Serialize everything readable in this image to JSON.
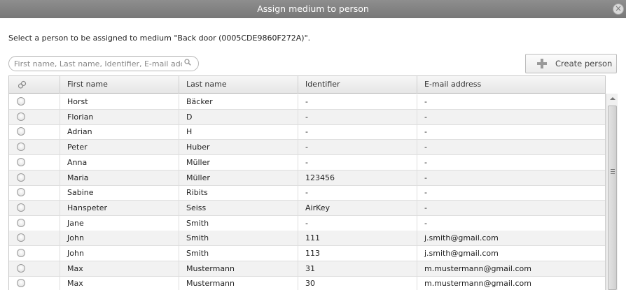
{
  "dialog": {
    "title": "Assign medium to person",
    "close_symbol": "×",
    "instruction": "Select a person to be assigned to medium \"Back door (0005CDE9860F272A)\"."
  },
  "search": {
    "placeholder": "First name, Last name, Identifier, E-mail address",
    "value": "",
    "icon": "search-icon"
  },
  "toolbar": {
    "create_label": "Create person",
    "create_icon": "plus-icon"
  },
  "table": {
    "select_icon": "link-icon",
    "columns": [
      "First name",
      "Last name",
      "Identifier",
      "E-mail address"
    ],
    "rows": [
      {
        "first": "Horst",
        "last": "Bäcker",
        "identifier": "-",
        "email": "-"
      },
      {
        "first": "Florian",
        "last": "D",
        "identifier": "-",
        "email": "-"
      },
      {
        "first": "Adrian",
        "last": "H",
        "identifier": "-",
        "email": "-"
      },
      {
        "first": "Peter",
        "last": "Huber",
        "identifier": "-",
        "email": "-"
      },
      {
        "first": "Anna",
        "last": "Müller",
        "identifier": "-",
        "email": "-"
      },
      {
        "first": "Maria",
        "last": "Müller",
        "identifier": "123456",
        "email": "-"
      },
      {
        "first": "Sabine",
        "last": "Ribits",
        "identifier": "-",
        "email": "-"
      },
      {
        "first": "Hanspeter",
        "last": "Seiss",
        "identifier": "AirKey",
        "email": "-"
      },
      {
        "first": "Jane",
        "last": "Smith",
        "identifier": "-",
        "email": "-"
      },
      {
        "first": "John",
        "last": "Smith",
        "identifier": "111",
        "email": "j.smith@gmail.com"
      },
      {
        "first": "John",
        "last": "Smith",
        "identifier": "113",
        "email": "j.smith@gmail.com"
      },
      {
        "first": "Max",
        "last": "Mustermann",
        "identifier": "31",
        "email": "m.mustermann@gmail.com"
      },
      {
        "first": "Max",
        "last": "Mustermann",
        "identifier": "30",
        "email": "m.mustermann@gmail.com"
      }
    ]
  },
  "colors": {
    "titlebar": "#808080",
    "row_alt": "#f2f2f2",
    "header": "#ececec"
  }
}
